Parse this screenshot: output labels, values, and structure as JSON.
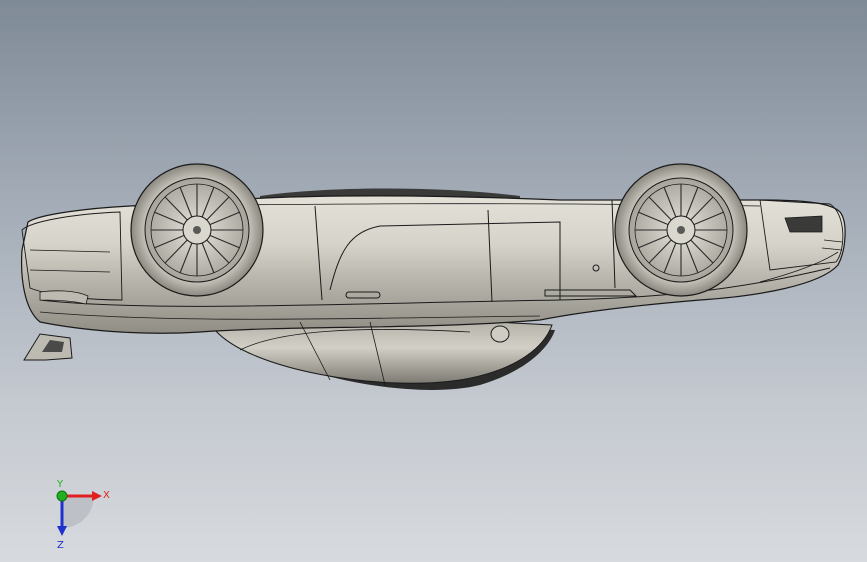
{
  "viewport": {
    "background_top": "#7f8a97",
    "background_bottom": "#d7dade"
  },
  "model": {
    "name": "car-body-upside-down",
    "body_color": "#c9c7bd",
    "line_color": "#1a1a1a"
  },
  "triad": {
    "x_label": "X",
    "y_label": "Y",
    "z_label": "Z",
    "x_color": "#e02020",
    "y_color": "#20b020",
    "z_color": "#2030d0"
  }
}
